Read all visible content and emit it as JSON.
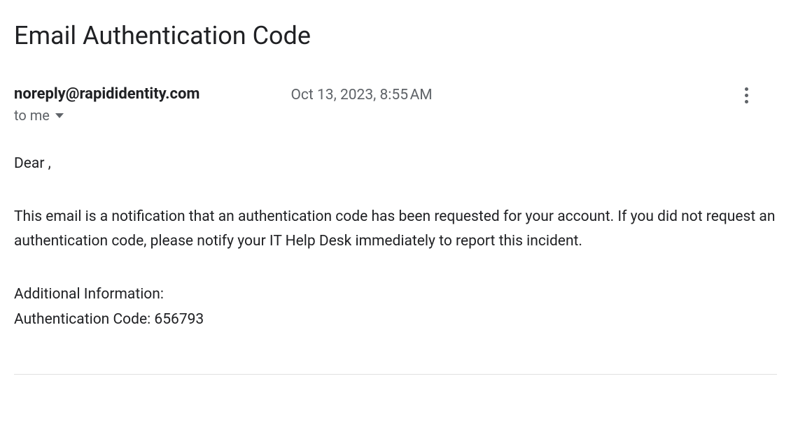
{
  "title": "Email Authentication Code",
  "sender": {
    "email": "noreply@rapididentity.com"
  },
  "recipient": {
    "label": "to me"
  },
  "timestamp": "Oct 13, 2023, 8:55 AM",
  "body": {
    "greeting": "Dear                         ,",
    "paragraph1": "This email is a notification that an authentication code has been requested for your account. If you did not request an authentication code, please notify your IT Help Desk immediately to report this incident.",
    "additional_info_label": "Additional Information:",
    "auth_code_label": "Authentication Code: ",
    "auth_code_value": "656793"
  }
}
